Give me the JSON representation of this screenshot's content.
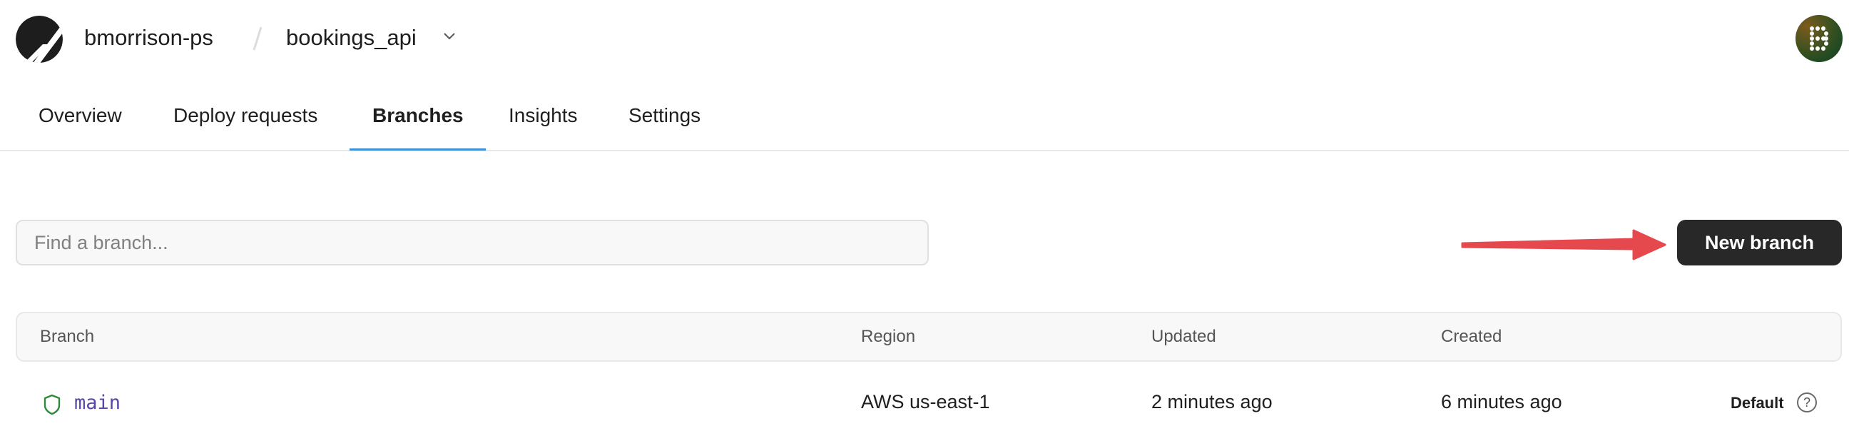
{
  "header": {
    "logo": "planetscale-logo-icon",
    "organization": "bmorrison-ps",
    "separator": "/",
    "database": "bookings_api",
    "database_dropdown_icon": "chevron-down-icon",
    "avatar_initial": "B"
  },
  "tabs": [
    {
      "label": "Overview",
      "active": false
    },
    {
      "label": "Deploy requests",
      "active": false
    },
    {
      "label": "Branches",
      "active": true
    },
    {
      "label": "Insights",
      "active": false
    },
    {
      "label": "Settings",
      "active": false
    }
  ],
  "search": {
    "placeholder": "Find a branch...",
    "value": ""
  },
  "actions": {
    "new_branch_label": "New branch"
  },
  "annotation": {
    "type": "arrow",
    "color": "#e5484d",
    "points_to": "New branch"
  },
  "table": {
    "columns": [
      "Branch",
      "Region",
      "Updated",
      "Created",
      ""
    ],
    "rows": [
      {
        "icon": "shield-icon",
        "branch": "main",
        "region": "AWS us-east-1",
        "updated": "2 minutes ago",
        "created": "6 minutes ago",
        "badge": "Default",
        "help_icon": "?"
      }
    ]
  },
  "colors": {
    "accent_tab_underline": "#3f8fd8",
    "branch_name": "#5b45a8",
    "shield": "#2f8a3a",
    "button_bg": "#282828",
    "arrow": "#e5484d"
  }
}
